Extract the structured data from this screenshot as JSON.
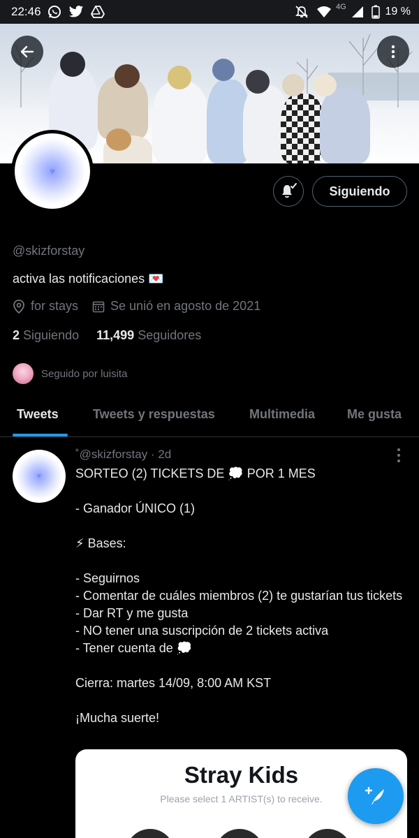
{
  "status_bar": {
    "time": "22:46",
    "network": "4G",
    "battery": "19 %"
  },
  "profile": {
    "handle": "@skizforstay",
    "bio": "activa las notificaciones 💌",
    "location": "for stays",
    "joined": "Se unió en agosto de 2021",
    "following_count": "2",
    "following_label": "Siguiendo",
    "followers_count": "11,499",
    "followers_label": "Seguidores",
    "followed_by": "Seguido por luisita",
    "follow_button": "Siguiendo"
  },
  "tabs": [
    {
      "label": "Tweets",
      "active": true
    },
    {
      "label": "Tweets y respuestas",
      "active": false
    },
    {
      "label": "Multimedia",
      "active": false
    },
    {
      "label": "Me gusta",
      "active": false
    }
  ],
  "tweet": {
    "header": "˚@skizforstay · 2d",
    "text": "SORTEO (2) TICKETS DE 💭 POR 1 MES\n\n- Ganador ÚNICO (1)\n\n⚡ Bases:\n\n- Seguirnos\n- Comentar de cuáles miembros (2) te gustarían tus tickets\n- Dar RT y me gusta\n- NO tener una suscripción de 2 tickets activa\n- Tener cuenta de 💭\n\nCierra: martes 14/09, 8:00 AM KST\n\n¡Mucha suerte!",
    "card": {
      "title": "Stray Kids",
      "subtitle": "Please select 1 ARTIST(s) to receive."
    }
  },
  "colors": {
    "accent": "#1d9bf0",
    "background": "#000000",
    "muted_text": "#71767b"
  }
}
